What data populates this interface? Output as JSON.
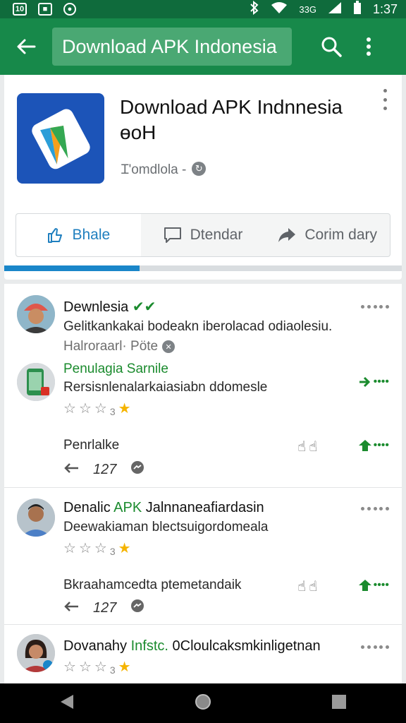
{
  "status_bar": {
    "left_icons": [
      "sim-icon",
      "notification-icon",
      "sync-icon"
    ],
    "left_labels": [
      "10",
      "■",
      "●"
    ],
    "right_icons": [
      "bluetooth-icon",
      "wifi-icon",
      "signal-icon",
      "battery-icon"
    ],
    "signal_label": "33G",
    "time": "1:37"
  },
  "app_bar": {
    "search_text": "Download APK Indonesia",
    "colors": {
      "bar": "#17894a",
      "status": "#0f6b3c",
      "field": "#4aa873"
    }
  },
  "app_header": {
    "title_line1": "Download APK Indnnesia",
    "title_line2": "ɵoH",
    "meta": "Ɪ'omdlola -",
    "meta_badge": "↻"
  },
  "actions": [
    {
      "label": "Bhale",
      "icon": "thumbs-up-icon",
      "active": true
    },
    {
      "label": "Dtendar",
      "icon": "comment-icon",
      "active": false
    },
    {
      "label": "Corim dary",
      "icon": "share-icon",
      "active": false
    }
  ],
  "progress": {
    "fraction": 0.34,
    "accent": "#1a86c9"
  },
  "reviews": [
    {
      "name": "Dewnlesia",
      "tag": "✔✔",
      "text": "Gelitkankakai bodeakn iberolacad odiaolesiu.",
      "meta": "Halroraarl· Pöte",
      "sub_title": "Penulagia Sarnile",
      "sub_text": "Rersisnlenalarkaiasiabn ddomesle",
      "rating_label": "3",
      "reply_label": "Penrlalke",
      "count": "127"
    },
    {
      "name": "Denalic",
      "tag": "APK",
      "name_rest": " Jalnnaneafiardasin",
      "text": "Deewakiaman blectsuigordomeala",
      "rating_label": "3",
      "reply_label": "Bkraahamcedta ptemetandaik",
      "count": "127"
    },
    {
      "name": "Dovanahy",
      "tag": "Infstc.",
      "name_rest": " 0Cloulcaksmkinligetnan",
      "rating_label": "3"
    }
  ]
}
